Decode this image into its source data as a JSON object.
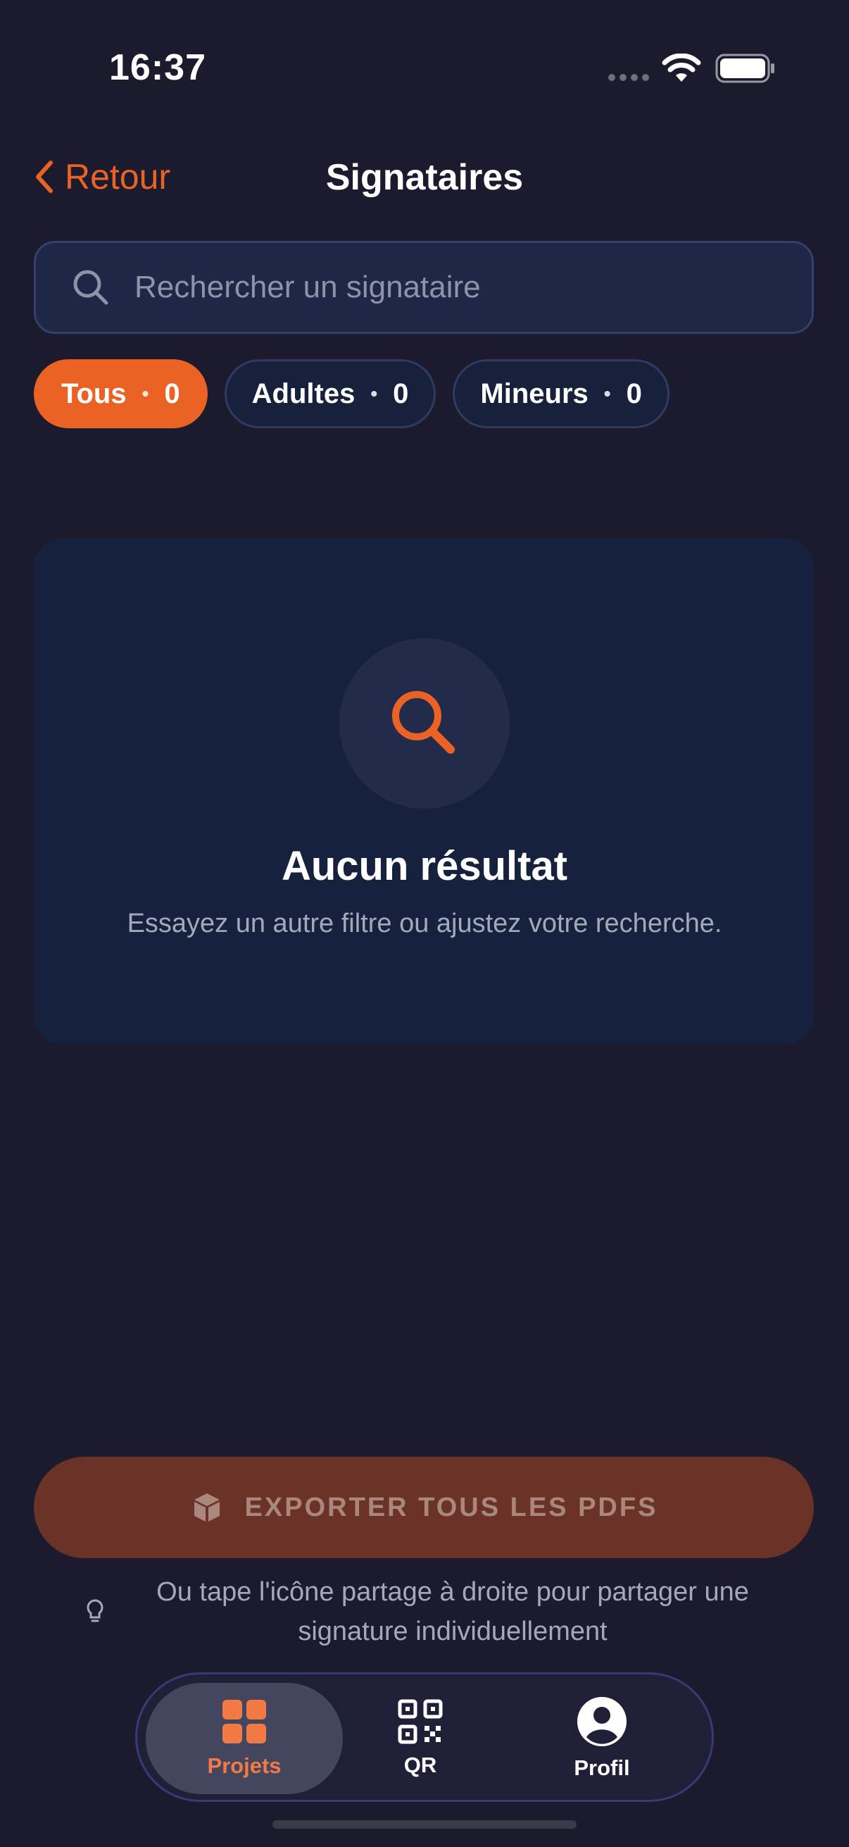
{
  "status_bar": {
    "time": "16:37"
  },
  "header": {
    "back_label": "Retour",
    "title": "Signataires"
  },
  "search": {
    "placeholder": "Rechercher un signataire"
  },
  "filters": [
    {
      "label": "Tous",
      "count": "0",
      "active": true
    },
    {
      "label": "Adultes",
      "count": "0",
      "active": false
    },
    {
      "label": "Mineurs",
      "count": "0",
      "active": false
    }
  ],
  "empty_state": {
    "icon": "search-icon",
    "title": "Aucun résultat",
    "subtitle": "Essayez un autre filtre ou ajustez votre recherche."
  },
  "export": {
    "label": "EXPORTER TOUS LES PDFS",
    "icon": "package-icon"
  },
  "hint": {
    "icon": "lightbulb-icon",
    "text": "Ou tape l'icône partage à droite pour partager une signature individuellement"
  },
  "tabbar": {
    "tabs": [
      {
        "label": "Projets",
        "icon": "grid-icon",
        "active": true
      },
      {
        "label": "QR",
        "icon": "qr-code-icon",
        "active": false
      },
      {
        "label": "Profil",
        "icon": "profile-icon",
        "active": false
      }
    ]
  },
  "colors": {
    "accent": "#ea6325",
    "background": "#1b1b2d",
    "card": "#16213d",
    "export_button": "#6b3328"
  }
}
